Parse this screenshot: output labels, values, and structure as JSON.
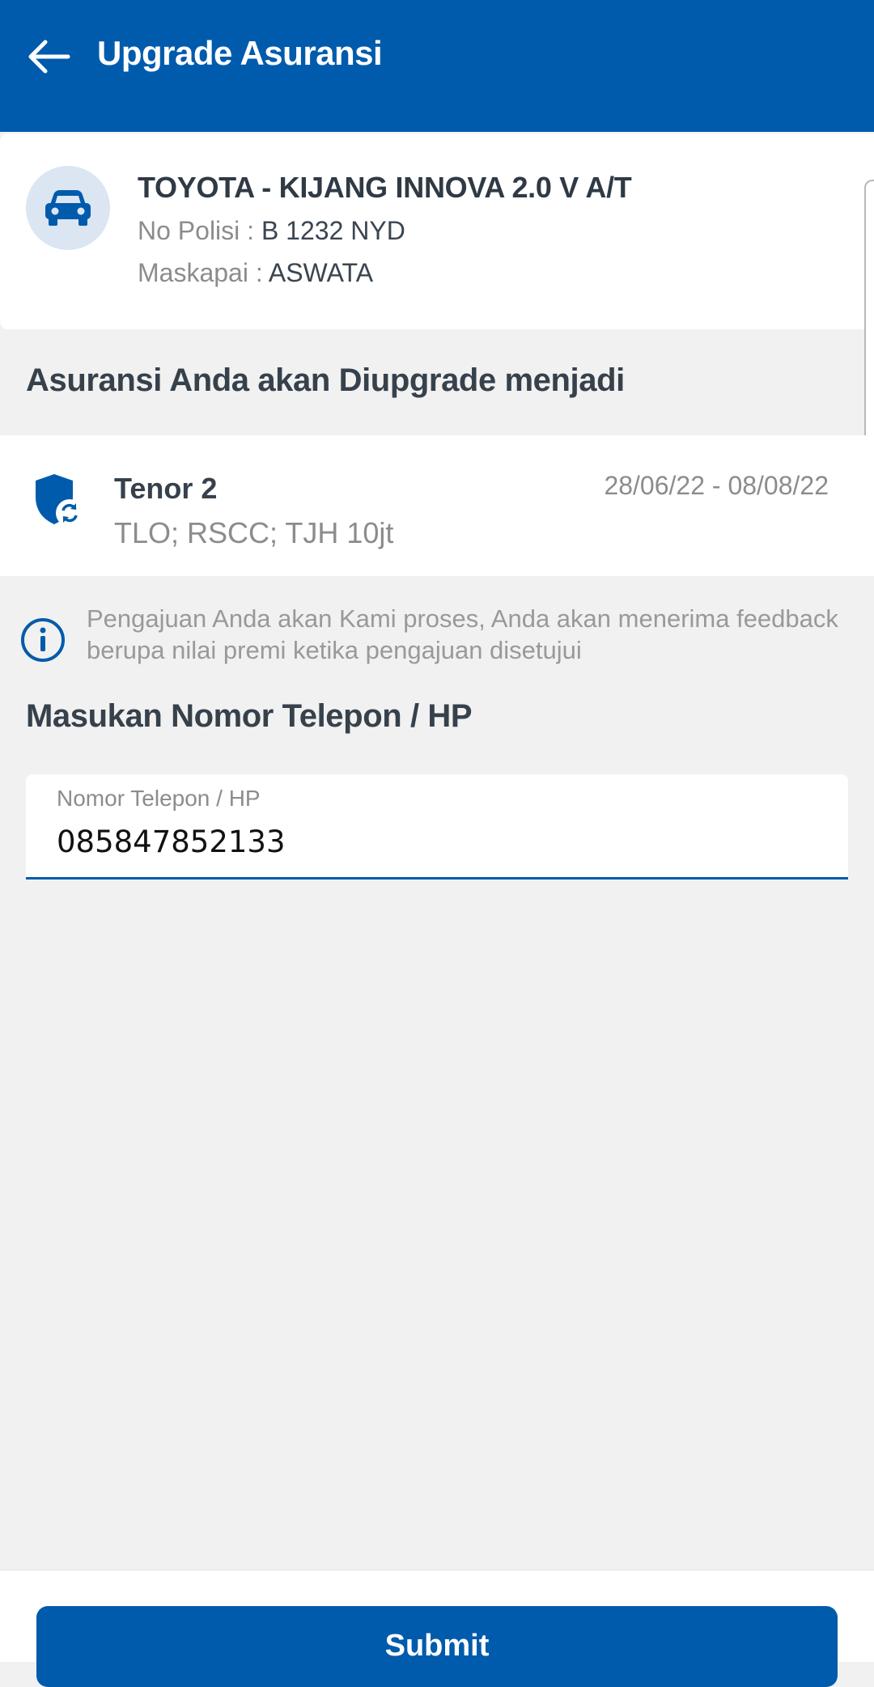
{
  "app_bar": {
    "title": "Upgrade Asuransi",
    "back_icon": "arrow-left-icon"
  },
  "vehicle": {
    "icon": "car-icon",
    "name": "TOYOTA - KIJANG INNOVA 2.0 V A/T",
    "police_no_label": "No Polisi :",
    "police_no": "B 1232 NYD",
    "insurer_label": "Maskapai :",
    "insurer": "ASWATA"
  },
  "upgrade_section": {
    "heading": "Asuransi Anda akan Diupgrade menjadi"
  },
  "tenor": {
    "icon": "shield-refresh-icon",
    "title": "Tenor 2",
    "coverage": "TLO; RSCC; TJH 10jt",
    "period": "28/06/22 - 08/08/22"
  },
  "notice": {
    "icon": "info-icon",
    "text": "Pengajuan Anda akan Kami proses, Anda akan menerima feedback berupa nilai premi ketika pengajuan disetujui"
  },
  "phone": {
    "heading": "Masukan Nomor Telepon / HP",
    "label": "Nomor Telepon / HP",
    "value": "085847852133"
  },
  "submit": {
    "label": "Submit"
  },
  "colors": {
    "primary": "#005bac",
    "background": "#f1f1f1",
    "avatar_bg": "#dbe6f2"
  }
}
